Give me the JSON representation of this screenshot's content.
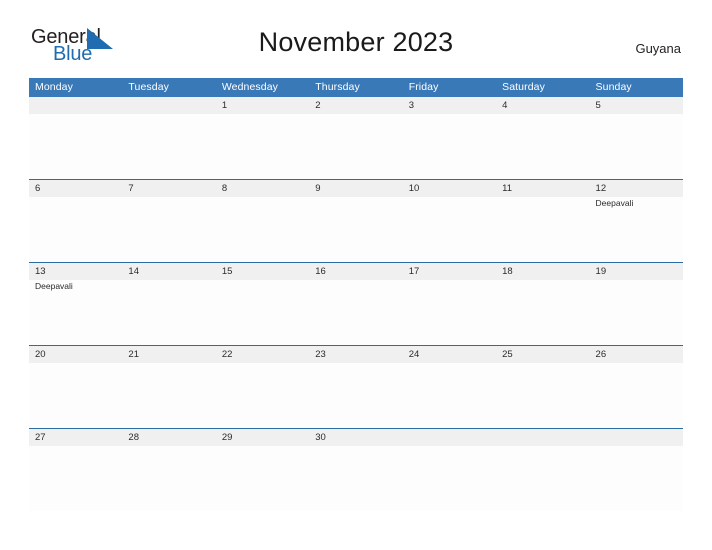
{
  "brand": {
    "name_part1": "General",
    "name_part2": "Blue",
    "triangle_color": "#1f6cb0"
  },
  "header": {
    "title": "November 2023",
    "country": "Guyana"
  },
  "colors": {
    "header_blue": "#3a79b8",
    "rule_blue": "#2b6ca3",
    "date_band": "#f0f0f0",
    "cell_bg": "#fdfdfd"
  },
  "calendar": {
    "weekday_headers": [
      "Monday",
      "Tuesday",
      "Wednesday",
      "Thursday",
      "Friday",
      "Saturday",
      "Sunday"
    ],
    "weeks": [
      {
        "dates": [
          "",
          "",
          "1",
          "2",
          "3",
          "4",
          "5"
        ],
        "events": [
          "",
          "",
          "",
          "",
          "",
          "",
          ""
        ]
      },
      {
        "dates": [
          "6",
          "7",
          "8",
          "9",
          "10",
          "11",
          "12"
        ],
        "events": [
          "",
          "",
          "",
          "",
          "",
          "",
          "Deepavali"
        ]
      },
      {
        "dates": [
          "13",
          "14",
          "15",
          "16",
          "17",
          "18",
          "19"
        ],
        "events": [
          "Deepavali",
          "",
          "",
          "",
          "",
          "",
          ""
        ]
      },
      {
        "dates": [
          "20",
          "21",
          "22",
          "23",
          "24",
          "25",
          "26"
        ],
        "events": [
          "",
          "",
          "",
          "",
          "",
          "",
          ""
        ]
      },
      {
        "dates": [
          "27",
          "28",
          "29",
          "30",
          "",
          "",
          ""
        ],
        "events": [
          "",
          "",
          "",
          "",
          "",
          "",
          ""
        ]
      }
    ]
  }
}
